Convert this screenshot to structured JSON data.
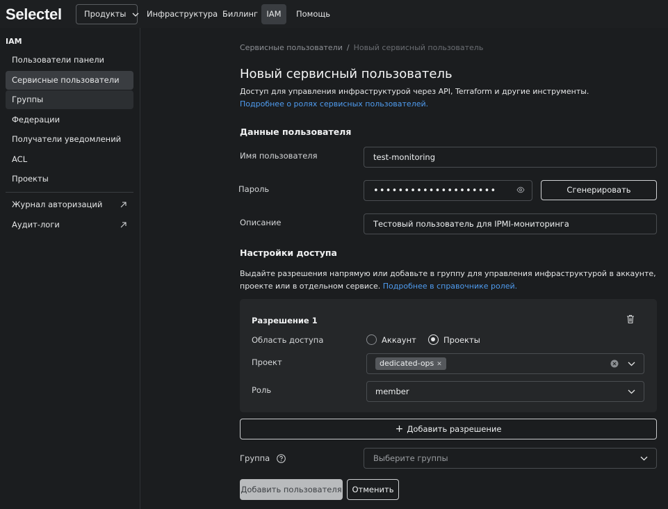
{
  "header": {
    "logo": "Selectel",
    "nav": {
      "products": "Продукты",
      "infrastructure": "Инфраструктура",
      "billing": "Биллинг",
      "iam": "IAM",
      "help": "Помощь"
    }
  },
  "sidebar": {
    "title": "IAM",
    "items": [
      {
        "label": "Пользователи панели"
      },
      {
        "label": "Сервисные пользователи"
      },
      {
        "label": "Группы"
      },
      {
        "label": "Федерации"
      },
      {
        "label": "Получатели уведомлений"
      },
      {
        "label": "ACL"
      },
      {
        "label": "Проекты"
      },
      {
        "label": "Журнал авторизаций"
      },
      {
        "label": "Аудит-логи"
      }
    ]
  },
  "breadcrumb": {
    "parent": "Сервисные пользователи",
    "separator": "/",
    "current": "Новый сервисный пользователь"
  },
  "page": {
    "title": "Новый сервисный пользователь",
    "description": "Доступ для управления инфраструктурой через API, Terraform и другие инструменты.",
    "link": "Подробнее о ролях сервисных пользователей."
  },
  "user_data": {
    "section_title": "Данные пользователя",
    "username_label": "Имя пользователя",
    "username_value": "test-monitoring",
    "password_label": "Пароль",
    "password_value": "••••••••••••••••••••",
    "generate_button": "Сгенерировать",
    "description_label": "Описание",
    "description_value": "Тестовый пользователь для IPMI-мониторинга"
  },
  "access": {
    "section_title": "Настройки доступа",
    "description": "Выдайте разрешения напрямую или добавьте в группу для управления инфраструктурой в аккаунте, проекте или в отдельном сервисе.",
    "link": "Подробнее в справочнике ролей.",
    "permission": {
      "title": "Разрешение 1",
      "scope_label": "Область доступа",
      "scope_options": [
        "Аккаунт",
        "Проекты"
      ],
      "scope_selected": "Проекты",
      "project_label": "Проект",
      "project_tag": "dedicated-ops",
      "role_label": "Роль",
      "role_value": "member"
    },
    "add_permission_button": "Добавить разрешение",
    "group_label": "Группа",
    "group_placeholder": "Выберите группы"
  },
  "actions": {
    "submit": "Добавить пользователя",
    "cancel": "Отменить"
  }
}
